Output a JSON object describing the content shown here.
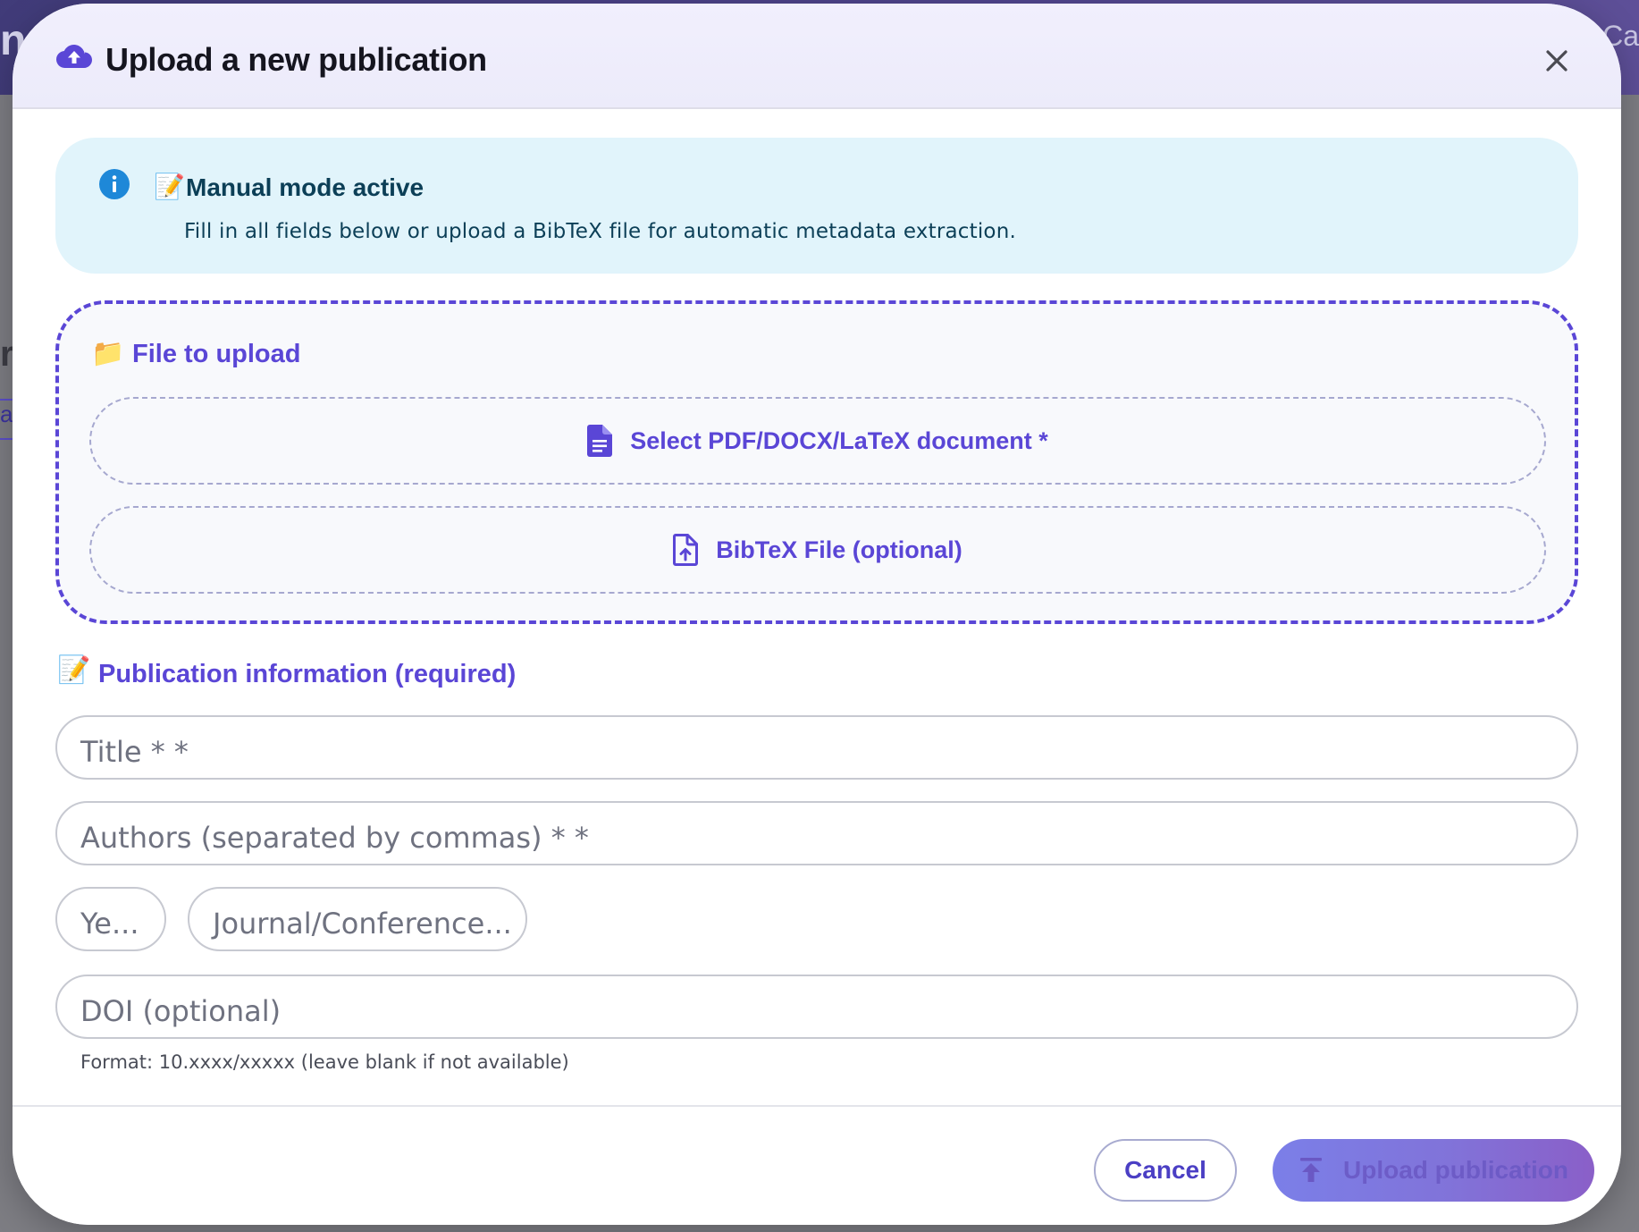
{
  "backdrop": {
    "left_fragment": "n",
    "right_fragment": "Ca",
    "side_fragment_1": "r",
    "side_fragment_2": "at"
  },
  "modal": {
    "title": "Upload a new publication",
    "header_icon": "cloud-upload-icon",
    "close_icon": "close-icon"
  },
  "alert": {
    "icon": "info-icon",
    "emoji": "📝",
    "title": "Manual mode active",
    "text": "Fill in all fields below or upload a BibTeX file for automatic metadata extraction."
  },
  "upload_zone": {
    "emoji": "📁",
    "title": "File to upload",
    "document_button": {
      "icon": "document-icon",
      "label": "Select PDF/DOCX/LaTeX document *"
    },
    "bibtex_button": {
      "icon": "file-upload-icon",
      "label": "BibTeX File (optional)"
    }
  },
  "publication_info": {
    "emoji": "📝",
    "title": "Publication information (required)",
    "fields": {
      "title_placeholder": "Title * *",
      "authors_placeholder": "Authors (separated by commas) * *",
      "year_placeholder": "Ye...",
      "journal_placeholder": "Journal/Conference...",
      "doi_placeholder": "DOI (optional)"
    },
    "doi_helper": "Format: 10.xxxx/xxxxx (leave blank if not available)"
  },
  "footer": {
    "cancel_label": "Cancel",
    "upload_label": "Upload publication",
    "upload_icon": "upload-arrow-icon"
  },
  "colors": {
    "accent": "#5a46d6",
    "alert_bg": "#e1f4fb",
    "alert_text": "#0c3f57",
    "header_bg": "#f1effd"
  }
}
